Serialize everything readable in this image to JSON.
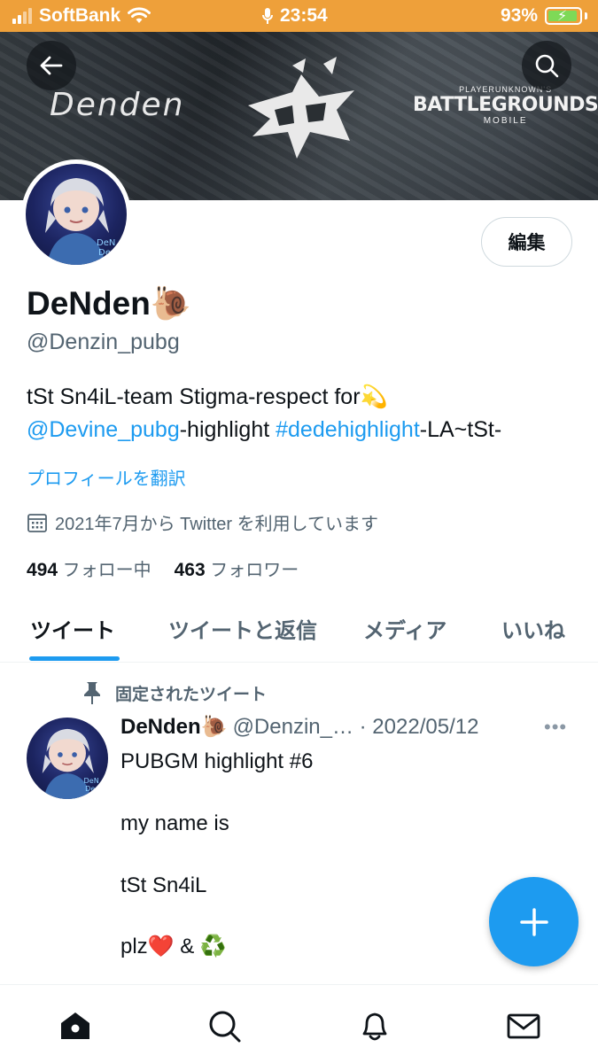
{
  "status_bar": {
    "carrier": "SoftBank",
    "time": "23:54",
    "battery": "93%",
    "battery_level": 0.93
  },
  "banner": {
    "name_text": "Denden",
    "game_line1": "PLAYERUNKNOWN'S",
    "game_line2": "BATTLEGROUNDS",
    "game_line3": "MOBILE"
  },
  "profile": {
    "edit_label": "編集",
    "display_name": "DeNden🐌",
    "handle": "@Denzin_pubg",
    "bio_line1": "tSt Sn4iL-team Stigma-respect for💫",
    "bio_mention": "@Devine_pubg",
    "bio_mid": "-highlight ",
    "bio_hashtag": "#dedehighlight",
    "bio_end": "-LA~tSt-",
    "translate": "プロフィールを翻訳",
    "joined": "2021年7月から Twitter を利用しています",
    "following_count": "494",
    "following_label": "フォロー中",
    "followers_count": "463",
    "followers_label": "フォロワー"
  },
  "tabs": [
    {
      "label": "ツイート"
    },
    {
      "label": "ツイートと返信"
    },
    {
      "label": "メディア"
    },
    {
      "label": "いいね"
    }
  ],
  "tweet": {
    "pinned_label": "固定されたツイート",
    "name": "DeNden🐌",
    "handle_date": "@Denzin_… · 2022/05/12",
    "more": "•••",
    "lines": [
      "PUBGM highlight #6",
      "my name is",
      "tSt Sn4iL",
      "plz❤️ & ♻️"
    ]
  }
}
